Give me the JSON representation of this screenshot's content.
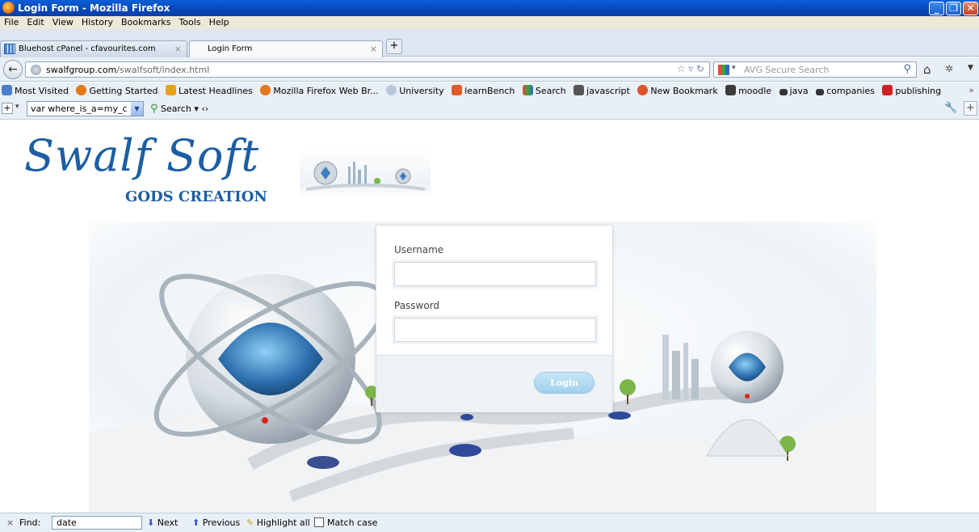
{
  "window": {
    "title": "Login Form - Mozilla Firefox"
  },
  "menu": [
    "File",
    "Edit",
    "View",
    "History",
    "Bookmarks",
    "Tools",
    "Help"
  ],
  "tabs": [
    {
      "label": "Bluehost cPanel - cfavourites.com"
    },
    {
      "label": "Login Form"
    }
  ],
  "nav": {
    "url_host": "swalfgroup.com",
    "url_path": "/swalfsoft/index.html",
    "search_placeholder": "AVG Secure Search"
  },
  "bookmarks": [
    {
      "label": "Most Visited",
      "icon": "most-visited-icon",
      "color": "#4a7fd0"
    },
    {
      "label": "Getting Started",
      "icon": "firefox-icon",
      "color": "#e2771c"
    },
    {
      "label": "Latest Headlines",
      "icon": "rss-icon",
      "color": "#e6a21d"
    },
    {
      "label": "Mozilla Firefox Web Br...",
      "icon": "firefox-icon",
      "color": "#e2771c"
    },
    {
      "label": "University",
      "icon": "university-icon",
      "color": "#b9c8dc"
    },
    {
      "label": "learnBench",
      "icon": "learnbench-icon",
      "color": "#e05a2a"
    },
    {
      "label": "Search",
      "icon": "search-engine-icon",
      "color": "#3a9a3a"
    },
    {
      "label": "javascript",
      "icon": "java-cup-icon",
      "color": "#555555"
    },
    {
      "label": "New Bookmark",
      "icon": "bookmark-icon",
      "color": "#e0522a"
    },
    {
      "label": "moodle",
      "icon": "moodle-icon",
      "color": "#3b3b3b"
    },
    {
      "label": "java",
      "icon": "java-icon",
      "color": "#333333"
    },
    {
      "label": "companies",
      "icon": "companies-icon",
      "color": "#333333"
    },
    {
      "label": "publishing",
      "icon": "youtube-icon",
      "color": "#d22020"
    }
  ],
  "toolbar": {
    "combo_value": "var where_is_a=my_c",
    "search_label": "Search"
  },
  "page": {
    "logo_title": "Swalf Soft",
    "logo_subtitle": "GODS CREATION",
    "username_label": "Username",
    "password_label": "Password",
    "login_button": "Login"
  },
  "findbar": {
    "label": "Find:",
    "value": "date",
    "next": "Next",
    "previous": "Previous",
    "highlight": "Highlight all",
    "matchcase": "Match case"
  }
}
